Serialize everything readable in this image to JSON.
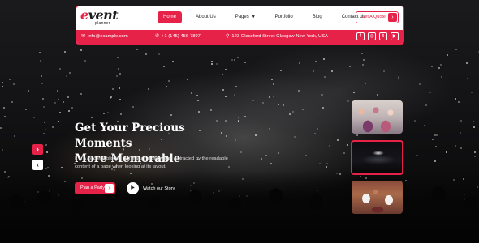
{
  "brand": {
    "logo_main": "event",
    "logo_sub": "planner",
    "accent_color": "#e62249"
  },
  "nav": {
    "items": [
      {
        "label": "Home",
        "active": true
      },
      {
        "label": "About Us",
        "active": false
      },
      {
        "label": "Pages",
        "active": false,
        "has_dropdown": true
      },
      {
        "label": "Portfolio",
        "active": false
      },
      {
        "label": "Blog",
        "active": false
      },
      {
        "label": "Contact Us",
        "active": false
      }
    ],
    "quote_button": "Get A Quote"
  },
  "info_bar": {
    "email": "info@example.com",
    "phone": "+1 (145) 456-7897",
    "address": "123 Glassford Street Glasgow New York, USA",
    "socials": [
      "facebook-icon",
      "instagram-icon",
      "twitter-icon",
      "youtube-icon"
    ]
  },
  "hero": {
    "title_line1": "Get Your Precious Moments",
    "title_line2": "More Memorable",
    "description": "It is a long established fact that a reader will be distracted by the readable content of a page when looking at its layout.",
    "primary_button": "Plan a Party",
    "watch_label": "Watch our Story"
  },
  "slider": {
    "thumbnails": [
      "celebration-photo",
      "concert-photo",
      "wedding-photo"
    ],
    "active_index": 1
  }
}
